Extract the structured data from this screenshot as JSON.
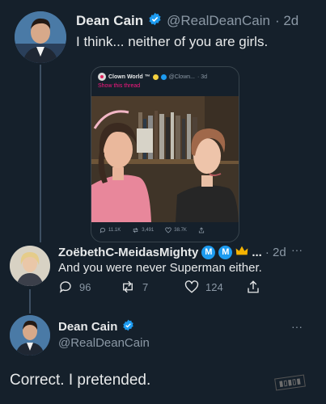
{
  "tweet1": {
    "display_name": "Dean Cain",
    "handle": "@RealDeanCain",
    "time": "· 2d",
    "text": "I think... neither of you are girls."
  },
  "quoted": {
    "display_name": "Clown World ™",
    "handle": "@Clown...",
    "time": "· 3d",
    "show_thread": "Show this thread",
    "stats": {
      "replies": "11.1K",
      "retweets": "3,491",
      "likes": "38.7K"
    }
  },
  "tweet2": {
    "display_name": "ZoëbethC-MeidasMighty",
    "badges": [
      "M",
      "M"
    ],
    "ellipsis": "...",
    "time": "· 2d",
    "text": "And you were never Superman either.",
    "replies": "96",
    "retweets": "7",
    "likes": "124"
  },
  "tweet3": {
    "display_name": "Dean Cain",
    "handle": "@RealDeanCain",
    "text": "Correct. I pretended."
  },
  "colors": {
    "background": "#15202b",
    "verified": "#1d9bf0",
    "muted": "#8b98a5",
    "text": "#e7e9ea",
    "link": "#f91880"
  },
  "icons": [
    "verified-icon",
    "more-icon",
    "reply-icon",
    "retweet-icon",
    "like-icon",
    "share-icon"
  ]
}
